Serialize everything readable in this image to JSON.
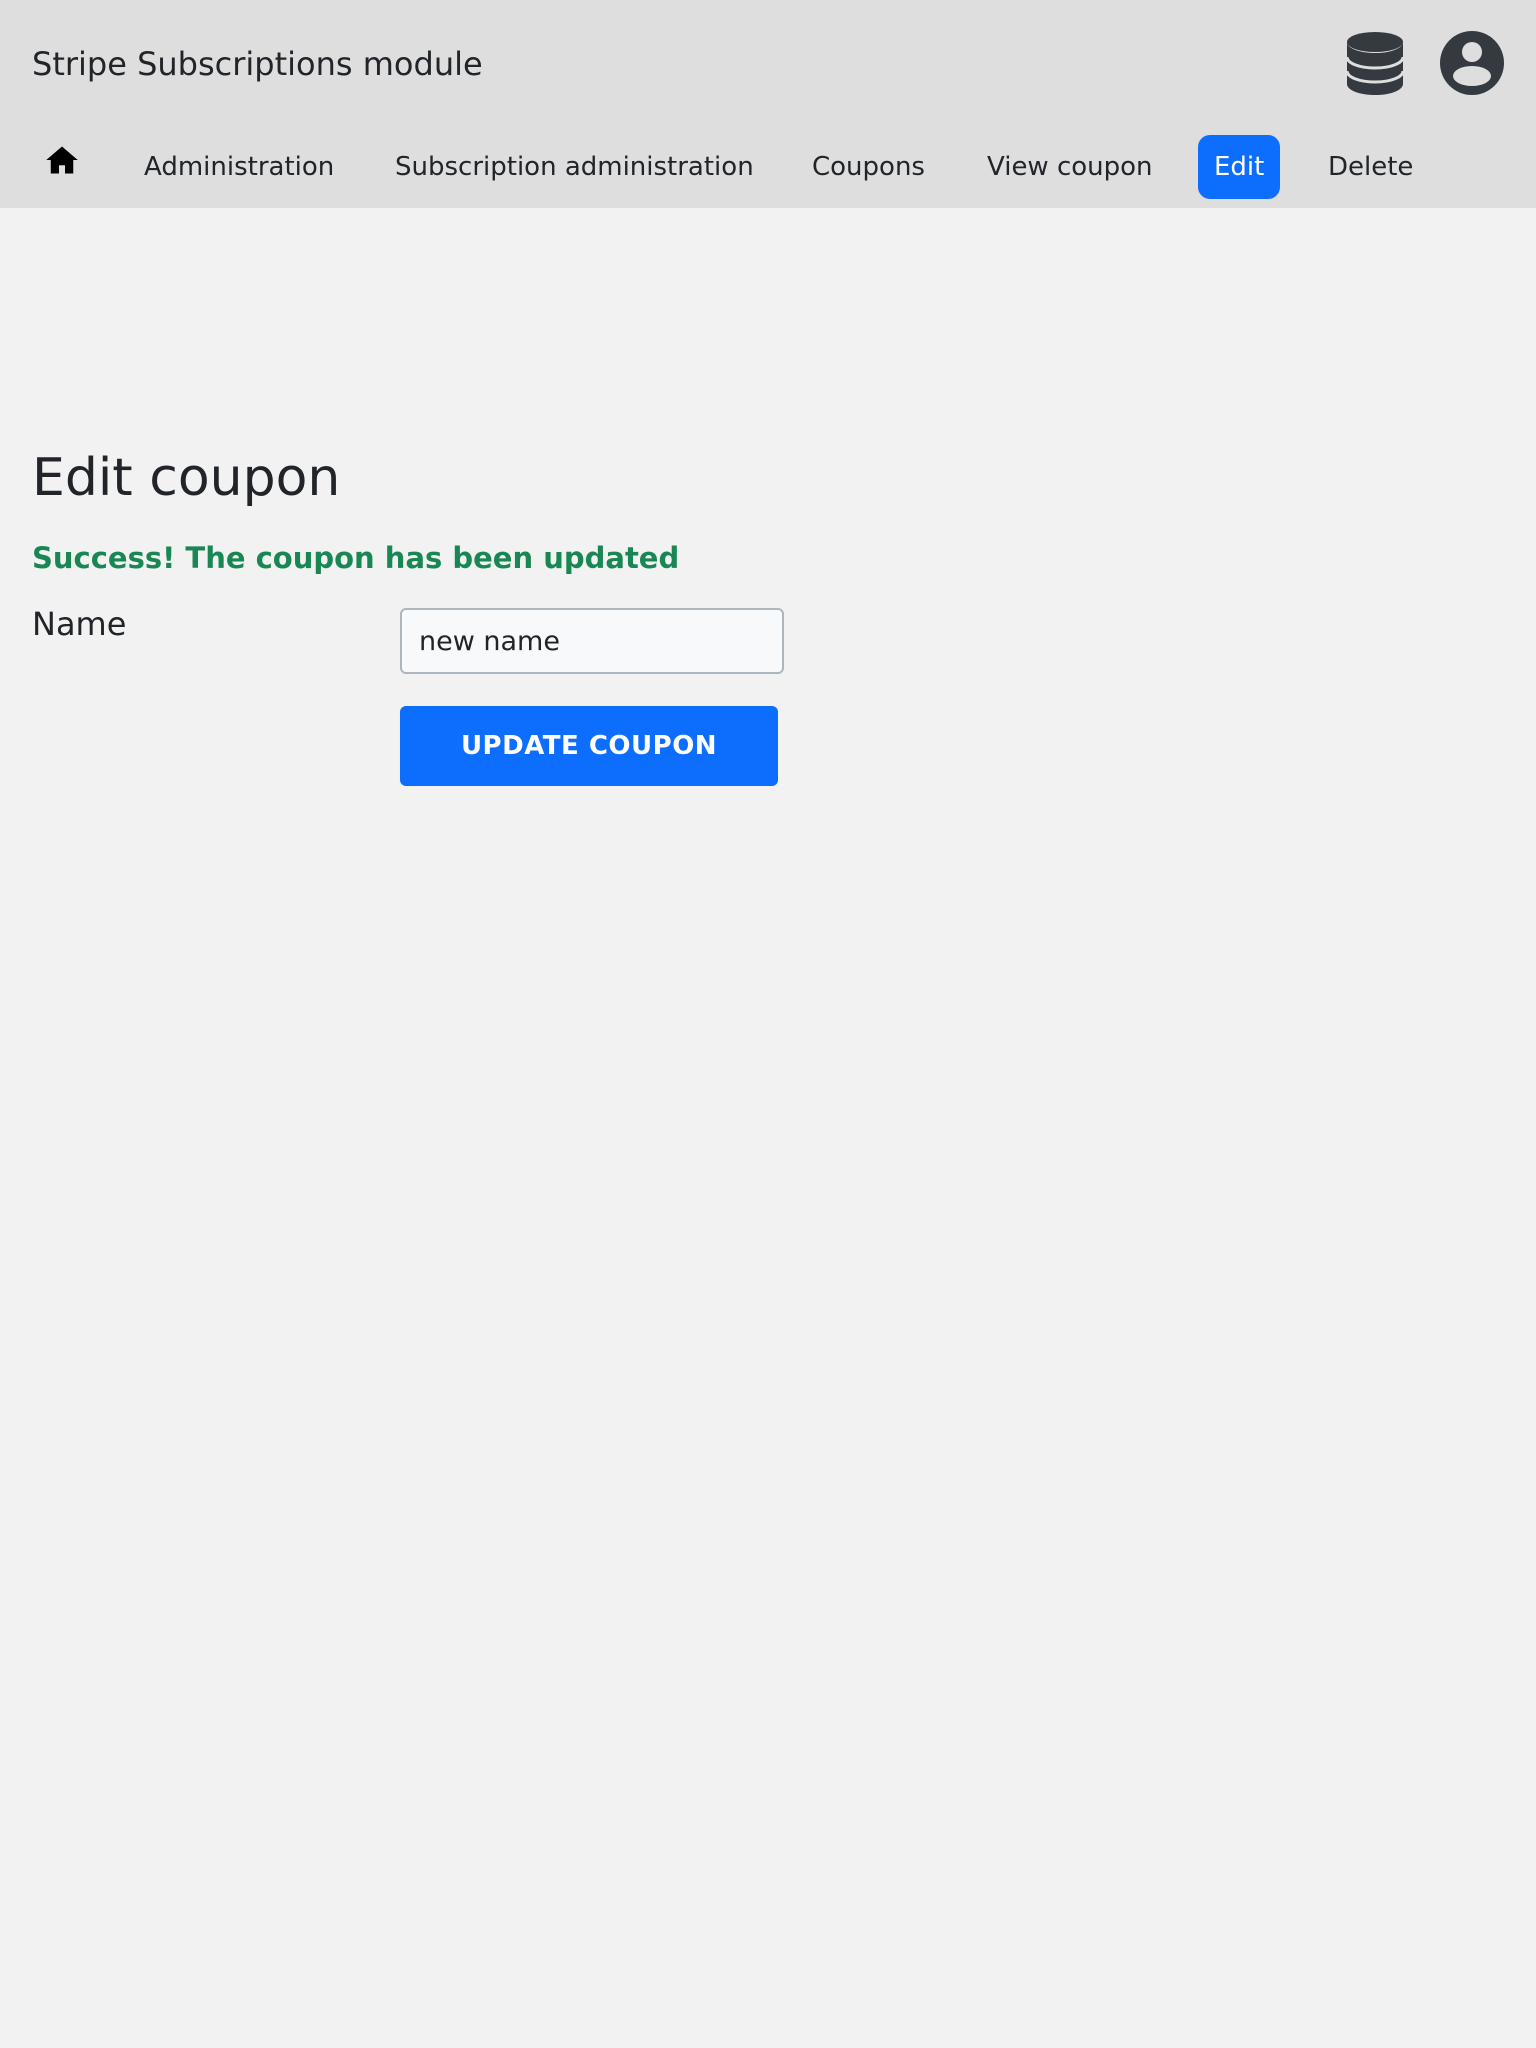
{
  "header": {
    "title": "Stripe Subscriptions module",
    "icons": [
      "database-icon",
      "user-account-icon"
    ]
  },
  "nav": {
    "home_icon": "home-icon",
    "items": [
      {
        "label": "Administration"
      },
      {
        "label": "Subscription administration"
      },
      {
        "label": "Coupons"
      },
      {
        "label": "View coupon"
      },
      {
        "label": "Edit",
        "active": true
      },
      {
        "label": "Delete"
      }
    ]
  },
  "main": {
    "title": "Edit coupon",
    "success_message": "Success! The coupon has been updated",
    "form": {
      "name_label": "Name",
      "name_value": "new name",
      "submit_label": "UPDATE COUPON"
    }
  },
  "colors": {
    "accent": "#0d6efd",
    "success": "#198754",
    "header_bg": "#dedede",
    "page_bg": "#f2f2f2"
  }
}
